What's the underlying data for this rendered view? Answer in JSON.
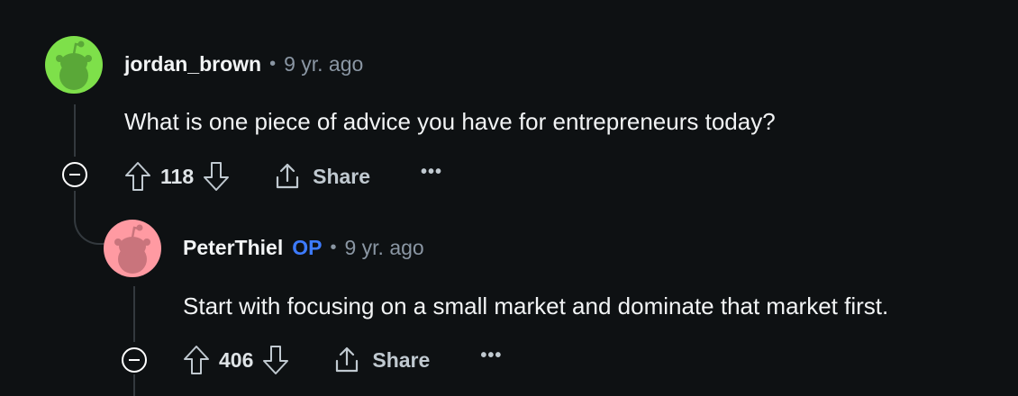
{
  "comments": [
    {
      "username": "jordan_brown",
      "time": "9 yr. ago",
      "body": "What is one piece of advice you have for entrepreneurs today?",
      "score": "118",
      "share_label": "Share",
      "more_label": "•••",
      "avatar_color": "#7ee04a"
    },
    {
      "username": "PeterThiel",
      "op_label": "OP",
      "time": "9 yr. ago",
      "body": "Start with focusing on a small market and dominate that market first.",
      "score": "406",
      "share_label": "Share",
      "more_label": "•••",
      "avatar_color": "#ff9aa2"
    }
  ],
  "separator": "•",
  "colors": {
    "background": "#0e1113",
    "op_accent": "#3d7bff",
    "muted_text": "#8a96a3"
  },
  "icons": [
    "upvote-icon",
    "downvote-icon",
    "share-icon",
    "more-icon",
    "collapse-icon",
    "snoo-avatar-icon"
  ]
}
